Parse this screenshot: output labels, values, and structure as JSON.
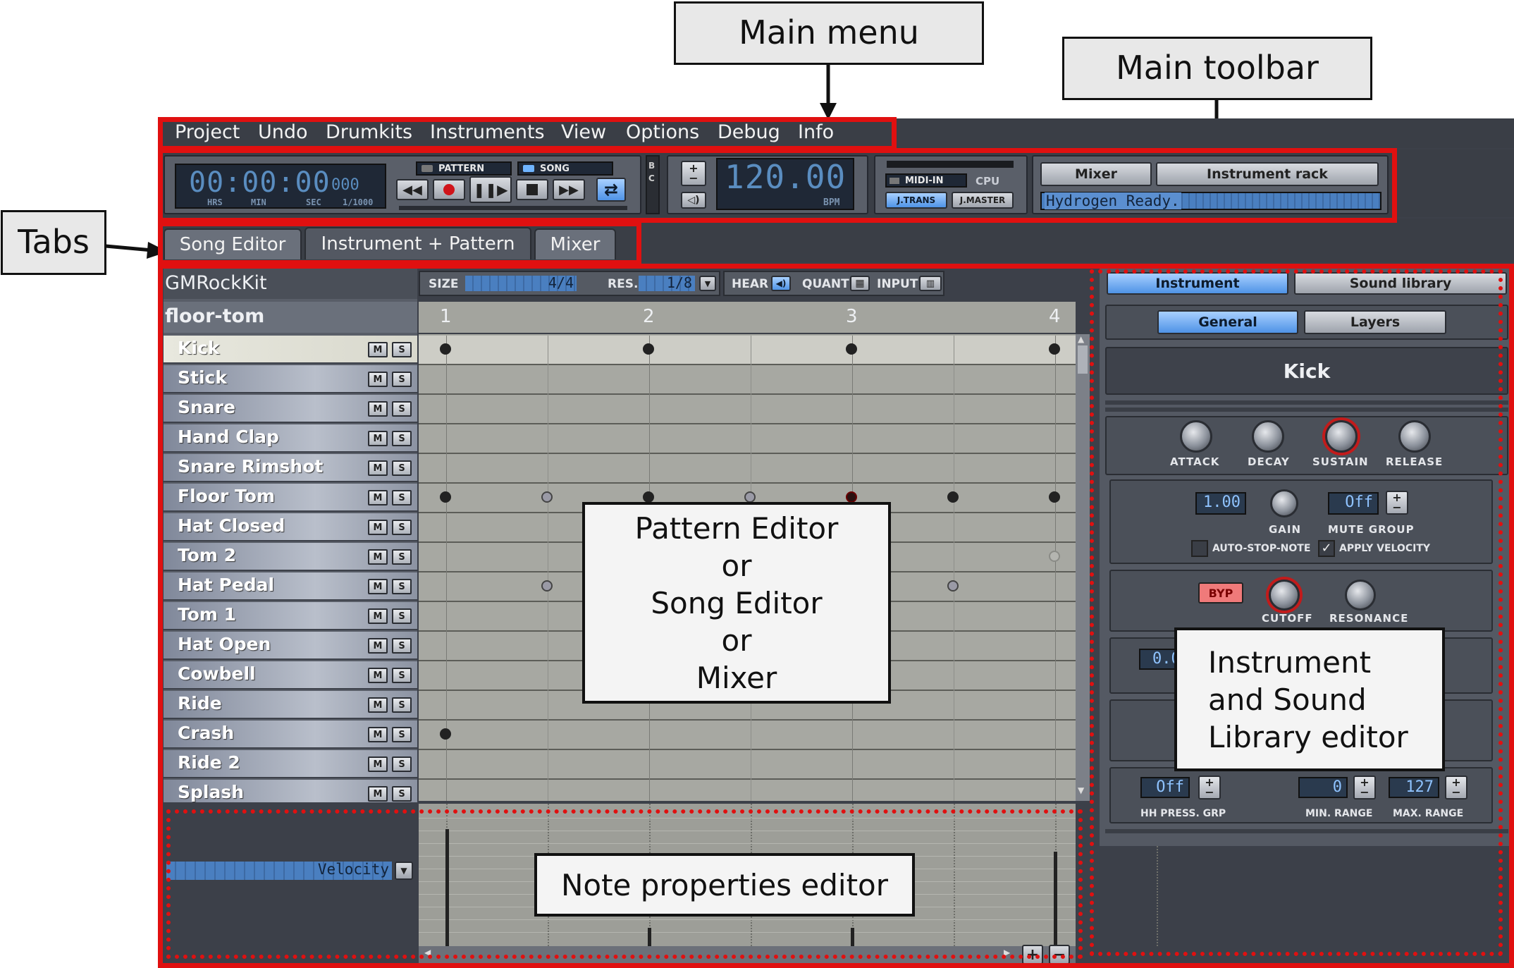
{
  "callouts": {
    "main_menu": "Main menu",
    "main_toolbar": "Main toolbar",
    "tabs": "Tabs"
  },
  "menu": [
    "Project",
    "Undo",
    "Drumkits",
    "Instruments",
    "View",
    "Options",
    "Debug",
    "Info"
  ],
  "transport": {
    "time": "00:00:00",
    "time_ms": "000",
    "time_units": [
      "HRS",
      "MIN",
      "SEC",
      "1/1000"
    ],
    "pattern_label": "PATTERN",
    "song_label": "SONG",
    "bc_label": "B C",
    "bpm": "120.00",
    "bpm_unit": "BPM",
    "midi_in": "MIDI-IN",
    "cpu": "CPU",
    "jtrans": "J.TRANS",
    "jmaster": "J.MASTER",
    "mixer_btn": "Mixer",
    "instrument_rack_btn": "Instrument rack",
    "status": "Hydrogen Ready."
  },
  "tabs": [
    "Song Editor",
    "Instrument + Pattern",
    "Mixer"
  ],
  "pattern_editor": {
    "drumkit": "GMRockKit",
    "pattern_name": "floor-tom",
    "size_label": "SIZE",
    "size_value": "4/4",
    "res_label": "RES.",
    "res_value": "1/8",
    "hear_label": "HEAR",
    "quant_label": "QUANT",
    "input_label": "INPUT",
    "beats": [
      "1",
      "2",
      "3",
      "4"
    ],
    "mute_label": "M",
    "solo_label": "S",
    "instruments": [
      "Kick",
      "Stick",
      "Snare",
      "Hand Clap",
      "Snare Rimshot",
      "Floor Tom",
      "Hat Closed",
      "Tom 2",
      "Hat Pedal",
      "Tom 1",
      "Hat Open",
      "Cowbell",
      "Ride",
      "Crash",
      "Ride 2",
      "Splash"
    ],
    "note_property": "Velocity",
    "overlay": [
      "Pattern Editor",
      "or",
      "Song Editor",
      "or",
      "Mixer"
    ]
  },
  "note_props_label": "Note properties editor",
  "instrument_editor": {
    "tab_instrument": "Instrument",
    "tab_sound_library": "Sound library",
    "tab_general": "General",
    "tab_layers": "Layers",
    "instrument_name": "Kick",
    "adsr": [
      "ATTACK",
      "DECAY",
      "SUSTAIN",
      "RELEASE"
    ],
    "gain_value": "1.00",
    "gain_label": "GAIN",
    "mute_group_value": "Off",
    "mute_group_label": "MUTE GROUP",
    "auto_stop": "AUTO-STOP-NOTE",
    "apply_velocity": "APPLY VELOCITY",
    "byp": "BYP",
    "cutoff": "CUTOFF",
    "resonance": "RESONANCE",
    "pitch_value": "0.00",
    "hh_value": "Off",
    "hh_label": "HH PRESS. GRP",
    "min_range_value": "0",
    "min_range_label": "MIN. RANGE",
    "max_range_value": "127",
    "max_range_label": "MAX. RANGE",
    "overlay": [
      "Instrument",
      "and Sound",
      "Library editor"
    ]
  }
}
